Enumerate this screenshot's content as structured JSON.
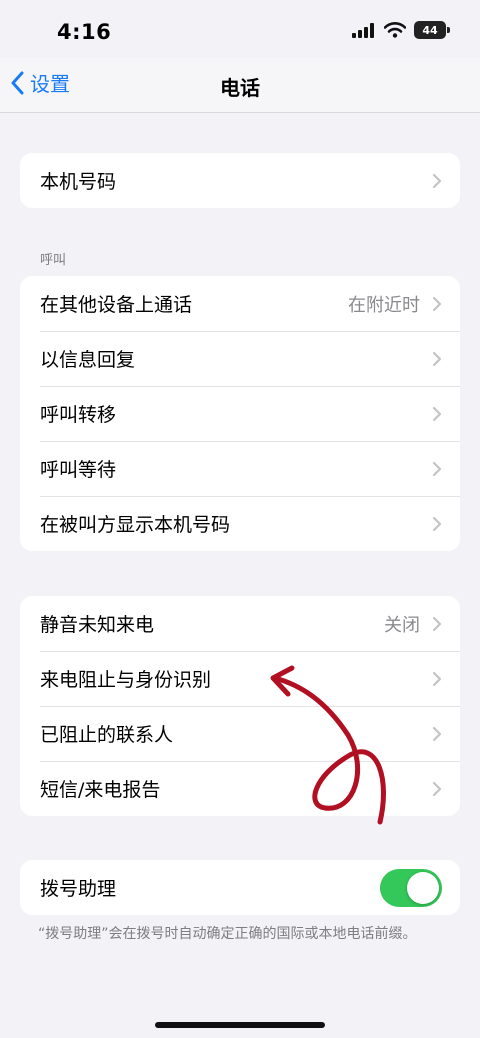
{
  "status_bar": {
    "time": "4:16",
    "battery": "44"
  },
  "nav": {
    "back_label": "设置",
    "title": "电话"
  },
  "group_my_number": {
    "items": [
      {
        "label": "本机号码"
      }
    ]
  },
  "section_calls": {
    "header": "呼叫"
  },
  "group_calls": {
    "items": [
      {
        "label": "在其他设备上通话",
        "value": "在附近时"
      },
      {
        "label": "以信息回复"
      },
      {
        "label": "呼叫转移"
      },
      {
        "label": "呼叫等待"
      },
      {
        "label": "在被叫方显示本机号码"
      }
    ]
  },
  "group_blocking": {
    "items": [
      {
        "label": "静音未知来电",
        "value": "关闭"
      },
      {
        "label": "来电阻止与身份识别"
      },
      {
        "label": "已阻止的联系人"
      },
      {
        "label": "短信/来电报告"
      }
    ]
  },
  "group_dial_assist": {
    "label": "拨号助理",
    "toggle_on": true,
    "footnote": "“拨号助理”会在拨号时自动确定正确的国际或本地电话前缀。"
  },
  "colors": {
    "accent": "#1a7cf5",
    "toggle_on": "#34c759",
    "annotation": "#b01021"
  }
}
